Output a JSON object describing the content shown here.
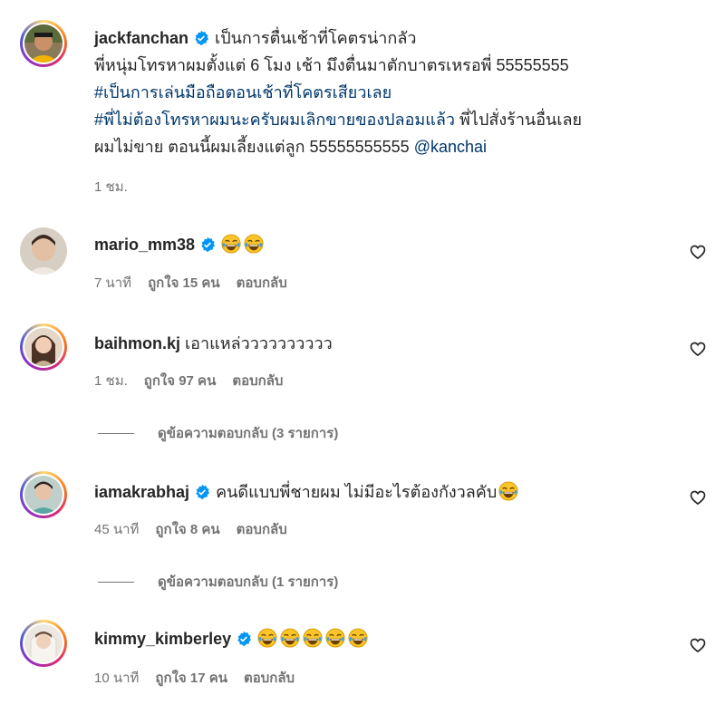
{
  "post": {
    "username": "jackfanchan",
    "line1": "เป็นการตื่นเช้าที่โคตรน่ากลัว",
    "line2": "พี่หนุ่มโทรหาผมตั้งแต่ 6 โมง เช้า มึงตื่นมาตักบาตรเหรอพี่ 55555555",
    "hashtag1": "#เป็นการเล่นมือถือตอนเช้าที่โคตรเสียวเลย",
    "hashtag2": "#พี่ไม่ต้องโทรหาผมนะครับผมเลิกขายของปลอมแล้ว",
    "line4_rest": "พี่ไปสั่งร้านอื่นเลย",
    "line5": "ผมไม่ขาย ตอนนี้ผมเลี้ยงแต่ลูก 55555555555",
    "mention": "@kanchai",
    "time": "1 ชม."
  },
  "comments": [
    {
      "username": "mario_mm38",
      "text": "",
      "emoji_count": 2,
      "time": "7 นาที",
      "likes": "ถูกใจ 15 คน",
      "reply": "ตอบกลับ"
    },
    {
      "username": "baihmon.kj",
      "text": "เอาแหล่วววววววววว",
      "emoji_count": 0,
      "time": "1 ชม.",
      "likes": "ถูกใจ 97 คน",
      "reply": "ตอบกลับ",
      "view_replies": "ดูข้อความตอบกลับ (3 รายการ)"
    },
    {
      "username": "iamakrabhaj",
      "text": "คนดีแบบพี่ชายผม ไม่มีอะไรต้องกังวลคับ",
      "emoji_count": 1,
      "time": "45 นาที",
      "likes": "ถูกใจ 8 คน",
      "reply": "ตอบกลับ",
      "view_replies": "ดูข้อความตอบกลับ (1 รายการ)"
    },
    {
      "username": "kimmy_kimberley",
      "text": "",
      "emoji_count": 5,
      "time": "10 นาที",
      "likes": "ถูกใจ 17 คน",
      "reply": "ตอบกลับ"
    }
  ],
  "icons": {
    "verified": "verified-badge-icon",
    "heart": "heart-outline-icon",
    "emoji": "face-with-tears-of-joy-icon"
  },
  "colors": {
    "verified": "#0095f6",
    "link": "#00376b",
    "muted": "#737373"
  }
}
